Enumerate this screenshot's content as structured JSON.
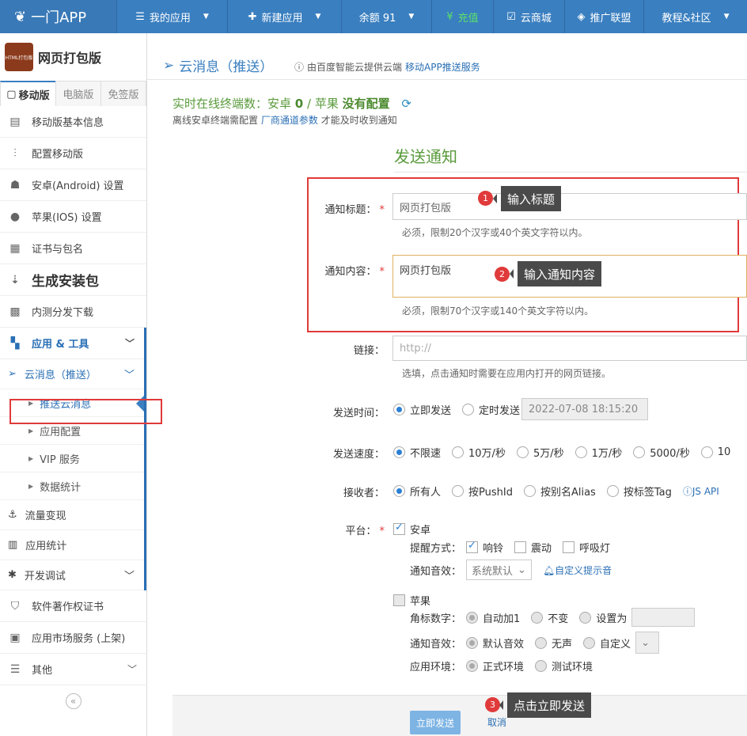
{
  "topbar": {
    "brand": "一门APP",
    "my_apps": "我的应用",
    "new_app": "新建应用",
    "balance": "余额 91",
    "recharge": "充值",
    "cloud_store": "云商城",
    "affiliate": "推广联盟",
    "tutorial": "教程&社区"
  },
  "app": {
    "name": "网页打包版",
    "logo_text": "HTML打包版"
  },
  "tabs": [
    "移动版",
    "电脑版",
    "免签版"
  ],
  "sidebar": {
    "basic_info": "移动版基本信息",
    "config": "配置移动版",
    "android": "安卓(Android) 设置",
    "ios": "苹果(IOS) 设置",
    "cert": "证书与包名",
    "build": "生成安装包",
    "beta": "内测分发下载",
    "tools": "应用 & 工具",
    "cloud_msg": "云消息（推送）",
    "push_msg": "推送云消息",
    "app_config": "应用配置",
    "vip": "VIP 服务",
    "stats_data": "数据统计",
    "traffic": "流量变现",
    "app_stats": "应用统计",
    "debug": "开发调试",
    "copyright": "软件著作权证书",
    "market": "应用市场服务 (上架)",
    "other": "其他",
    "collapse": "«"
  },
  "main": {
    "title": "云消息（推送）",
    "note_prefix": "由百度智能云提供云端",
    "note_link": "移动APP推送服务",
    "online_label": "实时在线终端数：安卓",
    "online_android": "0",
    "online_sep": "/ 苹果",
    "online_ios": "没有配置",
    "offline_pre": "离线安卓终端需配置",
    "offline_link": "厂商通道参数",
    "offline_post": "才能及时收到通知",
    "form_title": "发送通知",
    "title_label": "通知标题：",
    "title_value": "网页打包版",
    "title_help": "必须，限制20个汉字或40个英文字符以内。",
    "content_label": "通知内容：",
    "content_value": "网页打包版",
    "content_help": "必须，限制70个汉字或140个英文字符以内。",
    "link_label": "链接：",
    "link_placeholder": "http://",
    "link_help": "选填，点击通知时需要在应用内打开的网页链接。",
    "time_label": "发送时间：",
    "time_now": "立即发送",
    "time_scheduled": "定时发送",
    "time_value": "2022-07-08 18:15:20",
    "speed_label": "发送速度：",
    "speeds": [
      "不限速",
      "10万/秒",
      "5万/秒",
      "1万/秒",
      "5000/秒",
      "10"
    ],
    "receiver_label": "接收者：",
    "receivers": [
      "所有人",
      "按PushId",
      "按别名Alias",
      "按标签Tag"
    ],
    "js_api": "JS API",
    "platform_label": "平台：",
    "android": "安卓",
    "remind_label": "提醒方式：",
    "remind_ring": "响铃",
    "remind_vibrate": "震动",
    "remind_light": "呼吸灯",
    "sound_label": "通知音效：",
    "sound_value": "系统默认",
    "custom_sound": "自定义提示音",
    "ios": "苹果",
    "badge_label": "角标数字：",
    "badge_auto": "自动加1",
    "badge_keep": "不变",
    "badge_set": "设置为",
    "ios_sound_label": "通知音效：",
    "ios_sound_default": "默认音效",
    "ios_sound_none": "无声",
    "ios_sound_custom": "自定义",
    "env_label": "应用环境：",
    "env_prod": "正式环境",
    "env_test": "测试环境",
    "send_button": "立即发送",
    "cancel_button": "取消"
  },
  "annotations": {
    "step1": "1",
    "step1_text": "输入标题",
    "step2": "2",
    "step2_text": "输入通知内容",
    "step3": "3",
    "step3_text": "点击立即发送"
  }
}
